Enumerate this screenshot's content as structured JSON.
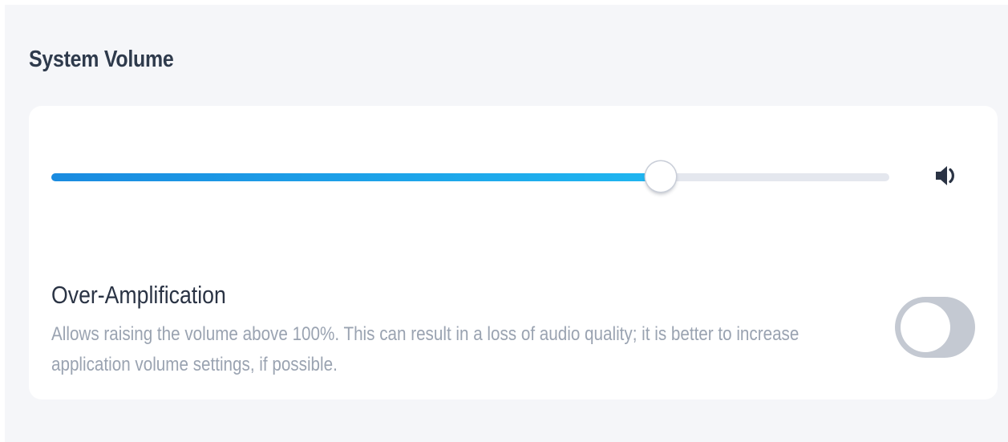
{
  "section": {
    "title": "System Volume"
  },
  "volume": {
    "level": 0.727,
    "icon": "speaker-volume-icon",
    "accent_color": "#1fa3ea"
  },
  "over_amplification": {
    "label": "Over-Amplification",
    "description": "Allows raising the volume above 100%. This can result in a loss of audio quality; it is better to increase application volume settings, if possible.",
    "enabled": false
  }
}
